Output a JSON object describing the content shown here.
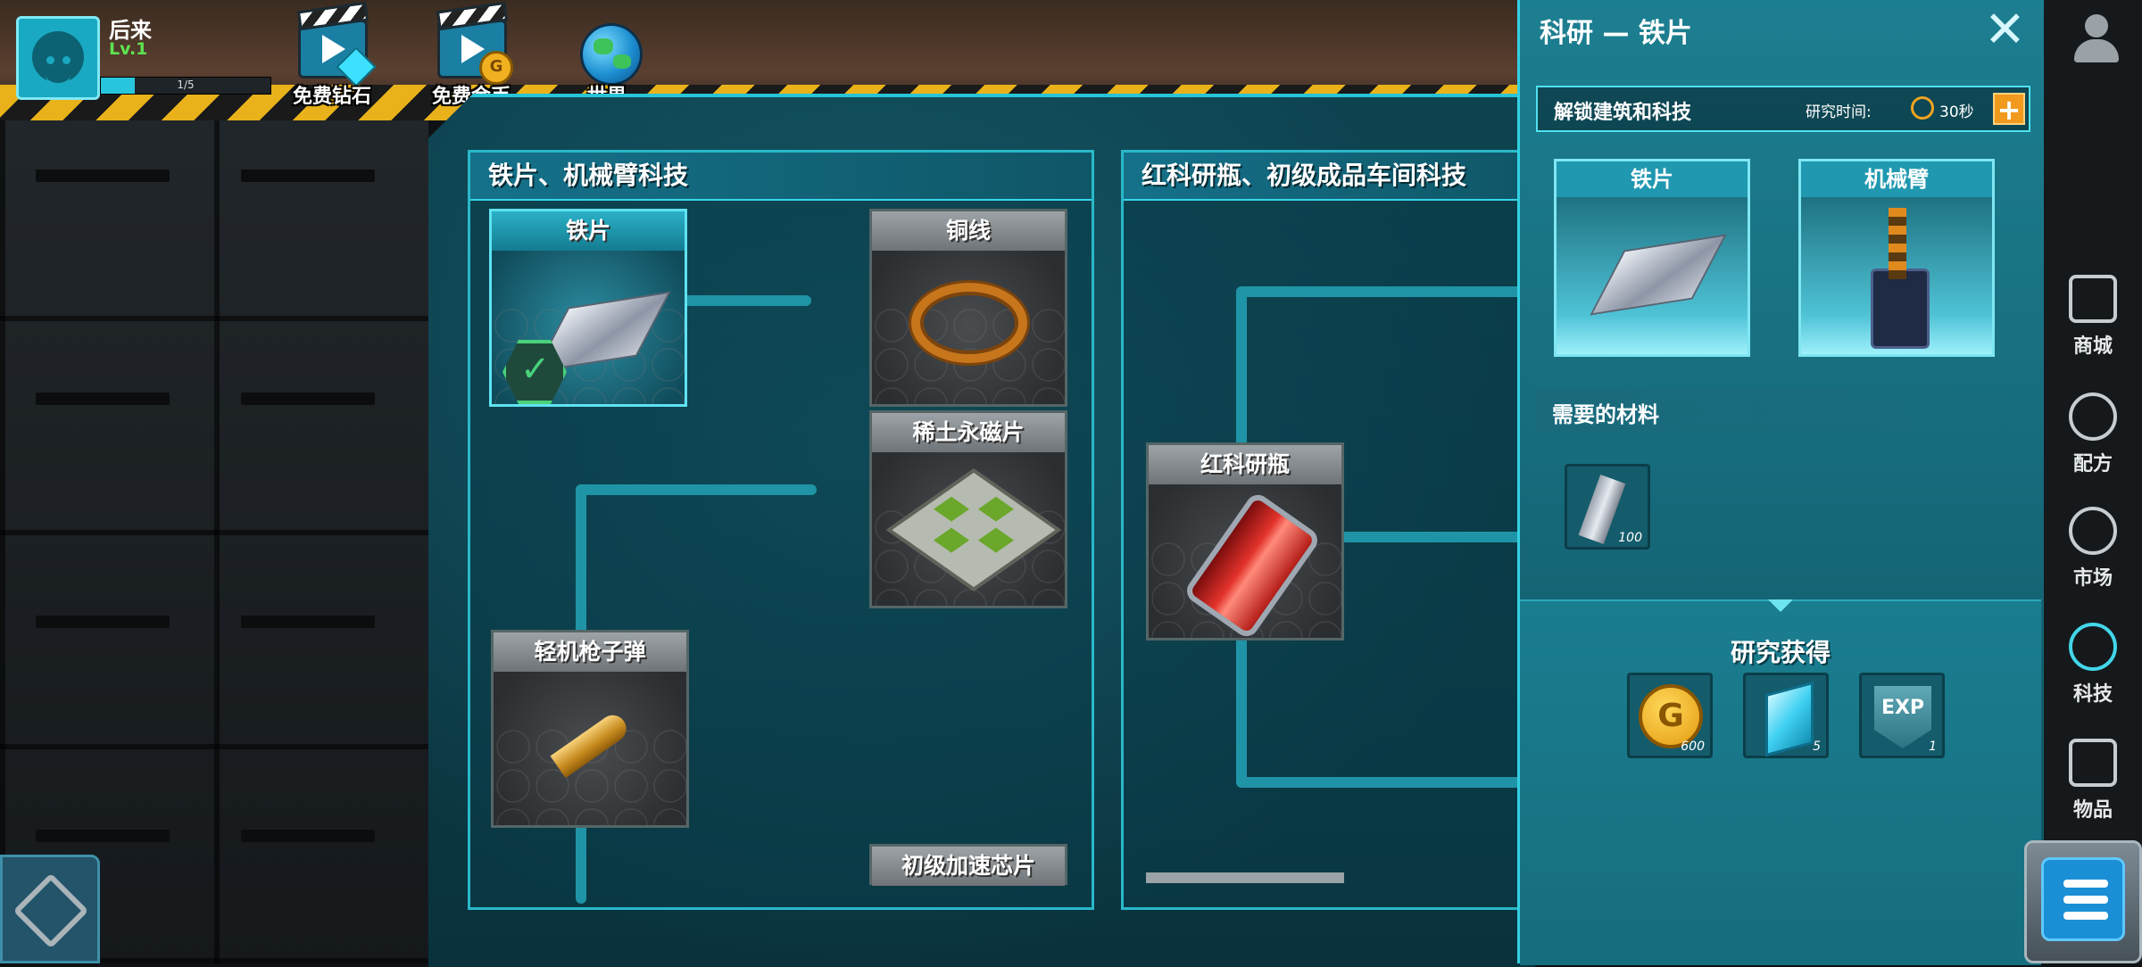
{
  "player": {
    "name": "后来",
    "level": "Lv.1",
    "xp_text": "1/5",
    "xp_fraction": 0.2
  },
  "hud": {
    "free_diamond": "免费钻石",
    "free_gold": "免费金币",
    "world": "世界",
    "gold_badge": "G"
  },
  "columns": [
    {
      "title": "铁片、机械臂科技"
    },
    {
      "title": "红科研瓶、初级成品车间科技"
    }
  ],
  "tech_cards": {
    "iron_plate": "铁片",
    "copper_wire": "铜线",
    "rare_earth_magnet": "稀土永磁片",
    "light_mg_bullet": "轻机枪子弹",
    "basic_accel_chip": "初级加速芯片",
    "red_research_flask": "红科研瓶",
    "check_mark": "✓"
  },
  "detail": {
    "title": "科研 — 铁片",
    "close": "✕",
    "unlock_label": "解锁建筑和科技",
    "research_time_label": "研究时间:",
    "research_time_value": "30秒",
    "plus": "+",
    "unlocks": [
      "铁片",
      "机械臂"
    ],
    "materials_label": "需要的材料",
    "materials": [
      {
        "icon": "iron-ingot-icon",
        "count": "100"
      }
    ],
    "reward_label": "研究获得",
    "rewards": [
      {
        "icon": "gold-coin-icon",
        "glyph": "G",
        "count": "600"
      },
      {
        "icon": "diamond-icon",
        "glyph": "",
        "count": "5"
      },
      {
        "icon": "exp-icon",
        "glyph": "EXP",
        "count": "1"
      }
    ]
  },
  "menu": {
    "items": [
      "商城",
      "配方",
      "市场",
      "科技",
      "物品"
    ],
    "active": "科技"
  },
  "colors": {
    "accent": "#29b8c9",
    "active_menu": "#43d6ea",
    "hazard": "#e9b21a"
  }
}
